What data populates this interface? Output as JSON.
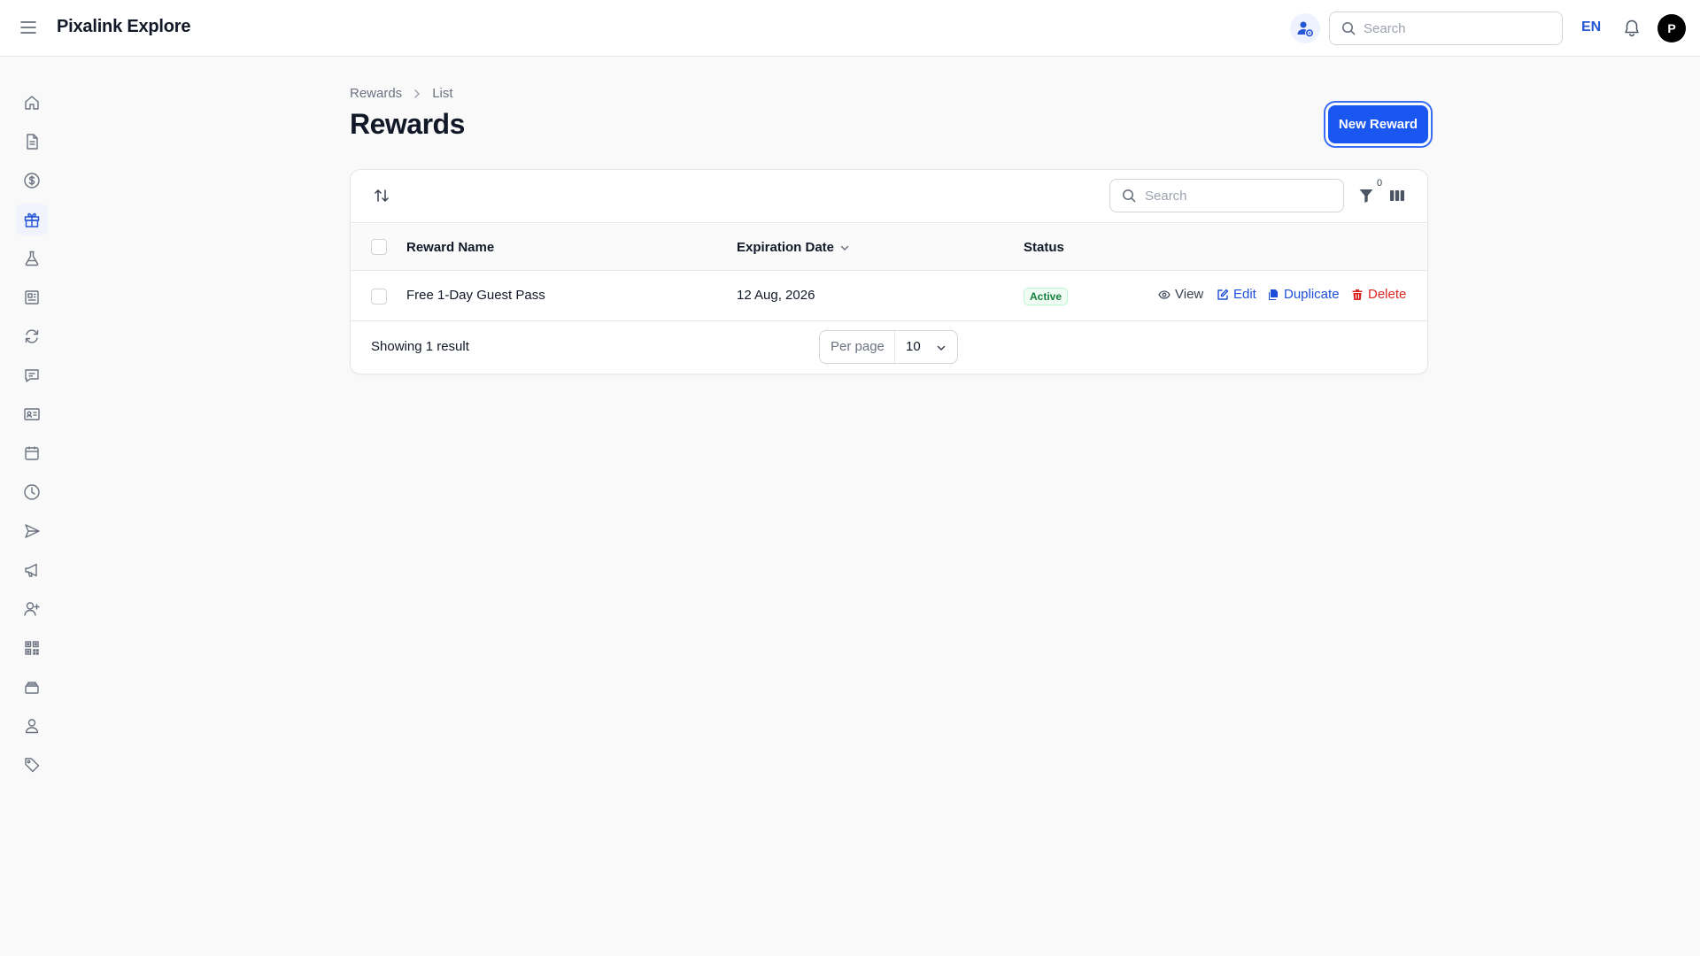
{
  "app": {
    "title": "Pixalink Explore"
  },
  "header": {
    "search_placeholder": "Search",
    "language": "EN",
    "avatar_initial": "P"
  },
  "sidebar": {
    "items": [
      {
        "icon": "home-icon"
      },
      {
        "icon": "document-icon"
      },
      {
        "icon": "dollar-icon"
      },
      {
        "icon": "gift-icon",
        "active": true
      },
      {
        "icon": "flask-icon"
      },
      {
        "icon": "newspaper-icon"
      },
      {
        "icon": "refresh-icon"
      },
      {
        "icon": "chat-icon"
      },
      {
        "icon": "id-card-icon"
      },
      {
        "icon": "calendar-icon"
      },
      {
        "icon": "clock-icon"
      },
      {
        "icon": "send-icon"
      },
      {
        "icon": "megaphone-icon"
      },
      {
        "icon": "user-plus-icon"
      },
      {
        "icon": "qr-code-icon"
      },
      {
        "icon": "inbox-stack-icon"
      },
      {
        "icon": "user-icon"
      },
      {
        "icon": "tag-icon"
      }
    ]
  },
  "breadcrumb": {
    "parent": "Rewards",
    "current": "List"
  },
  "page": {
    "title": "Rewards",
    "new_button": "New Reward"
  },
  "table": {
    "search_placeholder": "Search",
    "filter_count": "0",
    "columns": {
      "name": "Reward Name",
      "expiration": "Expiration Date",
      "status": "Status"
    },
    "rows": [
      {
        "name": "Free 1-Day Guest Pass",
        "expiration": "12 Aug, 2026",
        "status": "Active",
        "actions": {
          "view": "View",
          "edit": "Edit",
          "duplicate": "Duplicate",
          "delete": "Delete"
        }
      }
    ],
    "footer": {
      "results": "Showing 1 result",
      "per_page_label": "Per page",
      "per_page_value": "10"
    }
  },
  "colors": {
    "primary": "#1a56f0",
    "status_active": "#15803d",
    "danger": "#dc2626",
    "link": "#1d4ed8"
  }
}
